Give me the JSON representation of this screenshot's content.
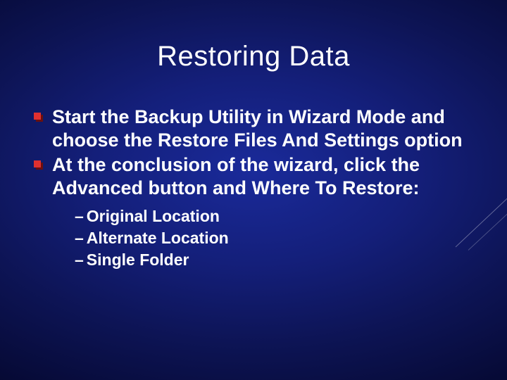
{
  "slide": {
    "title": "Restoring Data",
    "bullets": [
      {
        "text": "Start the Backup Utility in Wizard Mode and choose the Restore Files And Settings option"
      },
      {
        "text": "At the conclusion of the wizard, click the Advanced button and Where To Restore:",
        "sub": [
          "Original Location",
          "Alternate Location",
          "Single Folder"
        ]
      }
    ]
  }
}
